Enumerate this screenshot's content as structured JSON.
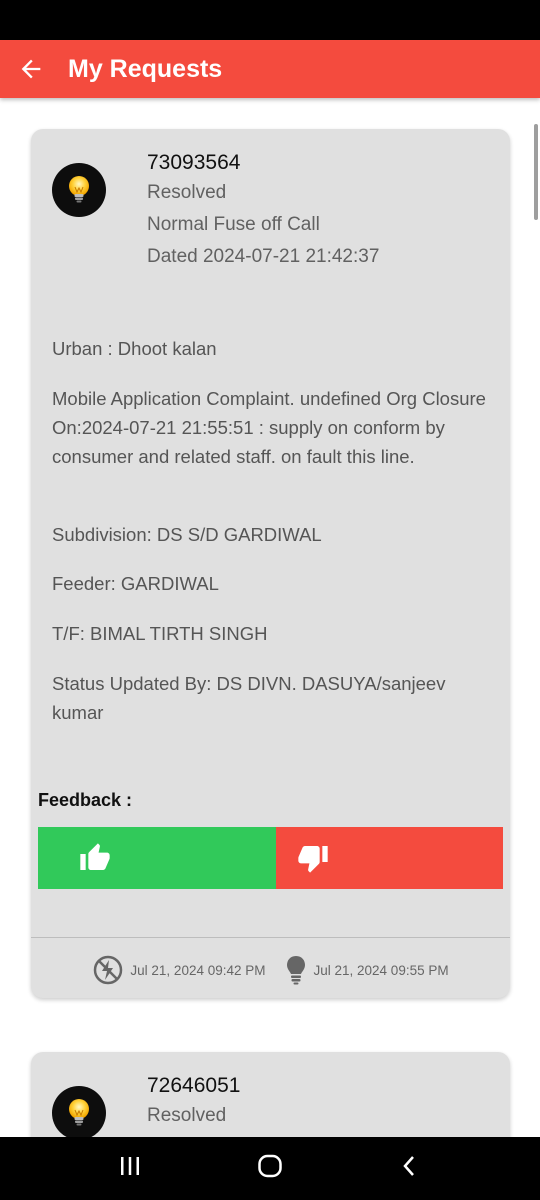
{
  "app_bar": {
    "title": "My Requests",
    "back_icon": "arrow-left-icon",
    "color": "#f44b3e"
  },
  "requests": [
    {
      "id": "73093564",
      "status": "Resolved",
      "type": "Normal Fuse off Call",
      "dated": "Dated 2024-07-21 21:42:37",
      "area": "Urban : Dhoot kalan",
      "remarks": "Mobile Application Complaint. undefined Org Closure On:2024-07-21 21:55:51 : supply on conform by consumer and related staff. on fault this line.",
      "subdivision": "Subdivision: DS S/D GARDIWAL",
      "feeder": "Feeder: GARDIWAL",
      "tf": "T/F: BIMAL TIRTH SINGH",
      "updated_by": "Status Updated By: DS DIVN. DASUYA/sanjeev kumar",
      "feedback_label": "Feedback :",
      "feedback_like_color": "#31c95a",
      "feedback_dislike_color": "#f44b3e",
      "complaint_time": "Jul 21, 2024 09:42 PM",
      "resolved_time": "Jul 21, 2024 09:55 PM"
    },
    {
      "id": "72646051",
      "status": "Resolved"
    }
  ]
}
